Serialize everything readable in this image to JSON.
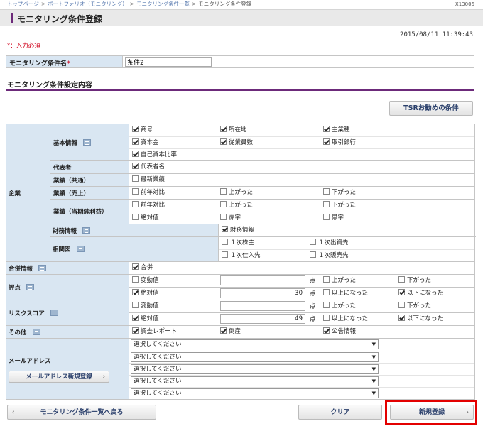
{
  "breadcrumb": [
    "トップページ",
    "ポートフォリオ（モニタリング）",
    "モニタリング条件一覧",
    "モニタリング条件登録"
  ],
  "screen_id": "X13006",
  "page_title": "モニタリング条件登録",
  "timestamp": "2015/08/11 11:39:43",
  "required_note": "*：入力必須",
  "condition_name": {
    "label": "モニタリング条件名",
    "required_mark": "*",
    "value": "条件2"
  },
  "section_title": "モニタリング条件設定内容",
  "tsr_button": "TSRお勧めの条件",
  "company": {
    "label": "企業",
    "basic": {
      "label": "基本情報",
      "items": [
        {
          "label": "商号",
          "checked": true
        },
        {
          "label": "所在地",
          "checked": true
        },
        {
          "label": "主業種",
          "checked": true
        },
        {
          "label": "資本金",
          "checked": true
        },
        {
          "label": "従業員数",
          "checked": true
        },
        {
          "label": "取引銀行",
          "checked": true
        },
        {
          "label": "自己資本比率",
          "checked": true
        }
      ]
    },
    "representative": {
      "label": "代表者",
      "items": [
        {
          "label": "代表者名",
          "checked": true
        }
      ]
    },
    "results_common": {
      "label": "業績（共通）",
      "items": [
        {
          "label": "最新業績",
          "checked": false
        }
      ]
    },
    "results_sales": {
      "label": "業績（売上）",
      "items": [
        {
          "label": "前年対比",
          "checked": false
        },
        {
          "label": "上がった",
          "checked": false
        },
        {
          "label": "下がった",
          "checked": false
        }
      ]
    },
    "results_profit": {
      "label": "業績（当期純利益）",
      "items": [
        {
          "label": "前年対比",
          "checked": false
        },
        {
          "label": "上がった",
          "checked": false
        },
        {
          "label": "下がった",
          "checked": false
        },
        {
          "label": "絶対値",
          "checked": false
        },
        {
          "label": "赤字",
          "checked": false
        },
        {
          "label": "黒字",
          "checked": false
        }
      ]
    }
  },
  "financial": {
    "label": "財務情報",
    "items": [
      {
        "label": "財務情報",
        "checked": true
      }
    ]
  },
  "relations": {
    "label": "相関図",
    "items": [
      {
        "label": "１次株主",
        "checked": false
      },
      {
        "label": "１次出資先",
        "checked": false
      },
      {
        "label": "１次仕入先",
        "checked": false
      },
      {
        "label": "１次販売先",
        "checked": false
      }
    ]
  },
  "merger": {
    "label": "合併情報",
    "items": [
      {
        "label": "合併",
        "checked": true
      }
    ]
  },
  "score": {
    "label": "評点",
    "unit": "点",
    "change": {
      "label": "変動値",
      "checked": false,
      "value": "",
      "up": {
        "label": "上がった",
        "checked": false
      },
      "down": {
        "label": "下がった",
        "checked": false
      }
    },
    "absolute": {
      "label": "絶対値",
      "checked": true,
      "value": "30",
      "up": {
        "label": "以上になった",
        "checked": false
      },
      "down": {
        "label": "以下になった",
        "checked": true
      }
    }
  },
  "risk": {
    "label": "リスクスコア",
    "unit": "点",
    "change": {
      "label": "変動値",
      "checked": false,
      "value": "",
      "up": {
        "label": "上がった",
        "checked": false
      },
      "down": {
        "label": "下がった",
        "checked": false
      }
    },
    "absolute": {
      "label": "絶対値",
      "checked": true,
      "value": "49",
      "up": {
        "label": "以上になった",
        "checked": false
      },
      "down": {
        "label": "以下になった",
        "checked": true
      }
    }
  },
  "other": {
    "label": "その他",
    "items": [
      {
        "label": "調査レポート",
        "checked": true
      },
      {
        "label": "倒産",
        "checked": true
      },
      {
        "label": "公告情報",
        "checked": true
      }
    ]
  },
  "email": {
    "label": "メールアドレス",
    "add_button": "メールアドレス新規登録",
    "selects": [
      "選択してください",
      "選択してください",
      "選択してください",
      "選択してください",
      "選択してください"
    ]
  },
  "footer": {
    "back": "モニタリング条件一覧へ戻る",
    "clear": "クリア",
    "register": "新規登録"
  },
  "colors": {
    "accent": "#6c2a7a",
    "label_bg": "#d9e6f2",
    "required": "#d0021b",
    "highlight": "#e30000"
  }
}
